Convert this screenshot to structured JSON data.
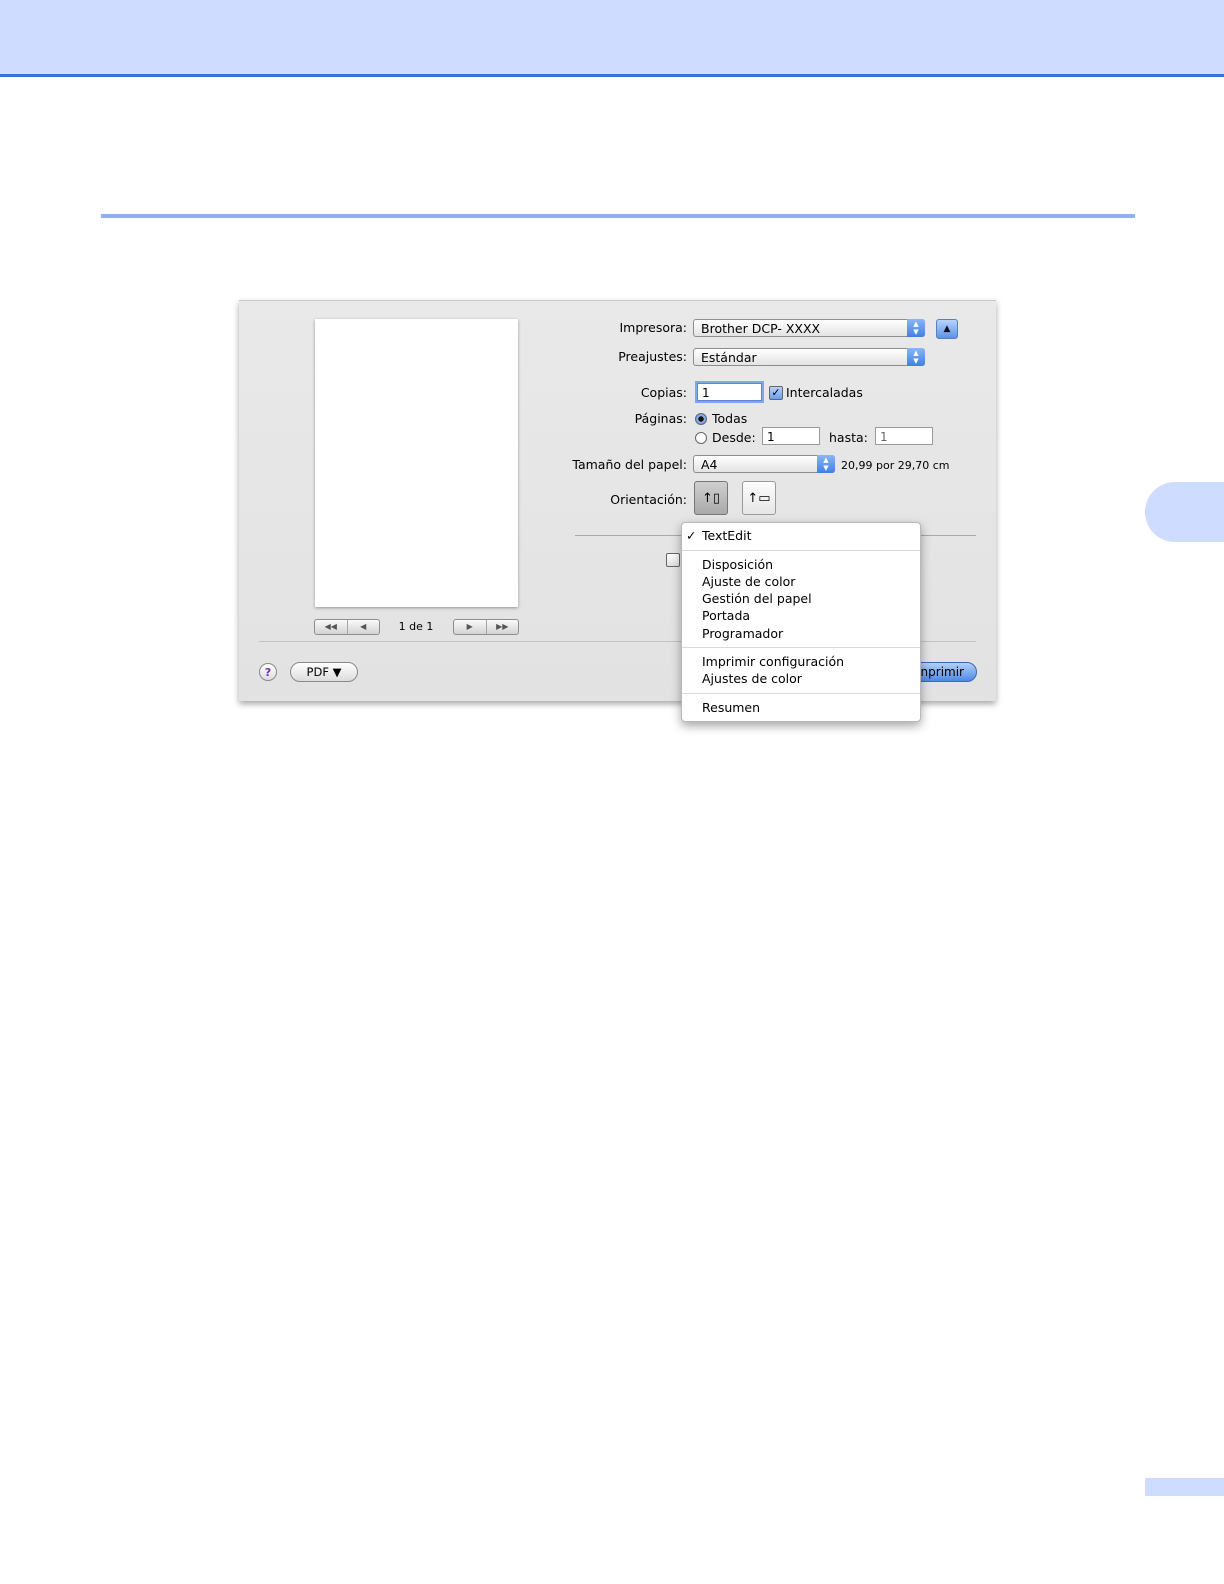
{
  "dialog": {
    "printer_label": "Impresora:",
    "printer_value": "Brother DCP- XXXX",
    "presets_label": "Preajustes:",
    "presets_value": "Estándar",
    "copies_label": "Copias:",
    "copies_value": "1",
    "collated_label": "Intercaladas",
    "pages_label": "Páginas:",
    "pages_all_label": "Todas",
    "pages_from_label": "Desde:",
    "pages_from_value": "1",
    "pages_to_label": "hasta:",
    "pages_to_value": "1",
    "paper_size_label": "Tamaño del papel:",
    "paper_size_value": "A4",
    "paper_dimensions": "20,99 por 29,70 cm",
    "orientation_label": "Orientación:",
    "page_counter": "1 de 1",
    "help_label": "?",
    "pdf_label": "PDF ▼",
    "print_label": "nprimir"
  },
  "menu": {
    "checkmark": "✓",
    "items": [
      "TextEdit",
      "Disposición",
      "Ajuste de color",
      "Gestión del papel",
      "Portada",
      "Programador",
      "Imprimir configuración",
      "Ajustes de color",
      "Resumen"
    ]
  }
}
